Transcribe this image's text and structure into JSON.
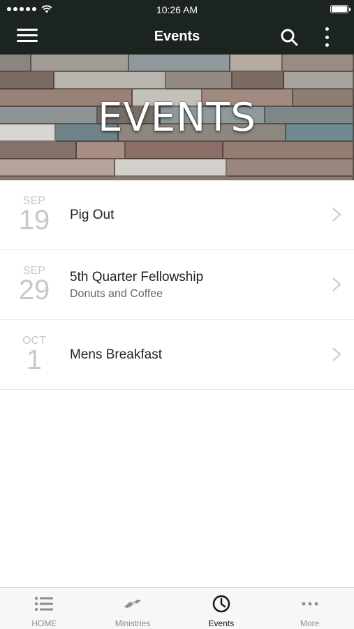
{
  "status_bar": {
    "time": "10:26 AM",
    "signal_icon": "signal-dots-icon",
    "wifi_icon": "wifi-icon",
    "battery_icon": "battery-icon"
  },
  "nav": {
    "title": "Events",
    "menu_icon": "hamburger-menu-icon",
    "search_icon": "search-icon",
    "more_icon": "more-vertical-icon"
  },
  "hero": {
    "title": "EVENTS"
  },
  "events": [
    {
      "month": "SEP",
      "day": "19",
      "title": "Pig Out",
      "subtitle": ""
    },
    {
      "month": "SEP",
      "day": "29",
      "title": "5th Quarter Fellowship",
      "subtitle": "Donuts and Coffee"
    },
    {
      "month": "OCT",
      "day": "1",
      "title": "Mens Breakfast",
      "subtitle": ""
    }
  ],
  "tabs": [
    {
      "label": "HOME",
      "icon": "list-icon",
      "active": false
    },
    {
      "label": "Ministries",
      "icon": "helping-hand-icon",
      "active": false
    },
    {
      "label": "Events",
      "icon": "clock-icon",
      "active": true
    },
    {
      "label": "More",
      "icon": "more-horizontal-icon",
      "active": false
    }
  ],
  "colors": {
    "header_bg": "#1c2420",
    "date_text": "#c8c8c8",
    "title_text": "#222222",
    "subtitle_text": "#666666",
    "tab_inactive": "#8e8e8e",
    "tab_active": "#111111"
  }
}
